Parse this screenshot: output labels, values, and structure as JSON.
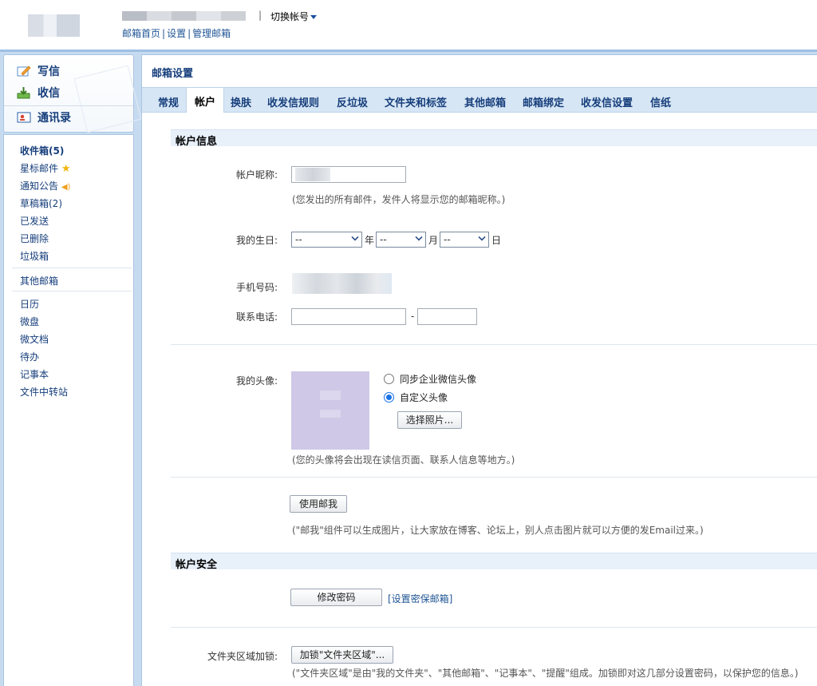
{
  "header": {
    "switch_account": "切换帐号",
    "links": [
      "邮箱首页",
      "设置",
      "管理邮箱"
    ],
    "separator": "|"
  },
  "sidebar": {
    "actions": [
      {
        "label": "写信",
        "icon": "compose-icon"
      },
      {
        "label": "收信",
        "icon": "inbox-download-icon"
      },
      {
        "label": "通讯录",
        "icon": "contacts-icon"
      }
    ],
    "folders": [
      {
        "label": "收件箱(5)",
        "bold": true
      },
      {
        "label": "星标邮件",
        "icon": "star-icon"
      },
      {
        "label": "通知公告",
        "icon": "speaker-icon"
      },
      {
        "label": "草稿箱(2)"
      },
      {
        "label": "已发送"
      },
      {
        "label": "已删除"
      },
      {
        "label": "垃圾箱"
      }
    ],
    "other_mail": "其他邮箱",
    "tools": [
      "日历",
      "微盘",
      "微文档",
      "待办",
      "记事本",
      "文件中转站"
    ]
  },
  "main": {
    "title": "邮箱设置",
    "tabs": [
      "常规",
      "帐户",
      "换肤",
      "收发信规则",
      "反垃圾",
      "文件夹和标签",
      "其他邮箱",
      "邮箱绑定",
      "收发信设置",
      "信纸"
    ],
    "active_tab": "帐户",
    "account_info": {
      "heading": "帐户信息",
      "nickname_label": "帐户昵称:",
      "nickname_hint": "(您发出的所有邮件，发件人将显示您的邮箱昵称。)",
      "birthday_label": "我的生日:",
      "birthday": {
        "year": "--",
        "month": "--",
        "day": "--",
        "year_unit": "年",
        "month_unit": "月",
        "day_unit": "日"
      },
      "phone_label": "手机号码:",
      "tel_label": "联系电话:",
      "tel_sep": "-",
      "avatar_label": "我的头像:",
      "avatar_options": [
        "同步企业微信头像",
        "自定义头像"
      ],
      "avatar_selected": "自定义头像",
      "choose_photo": "选择照片...",
      "avatar_hint": "(您的头像将会出现在读信页面、联系人信息等地方。)",
      "use_me_button": "使用邮我",
      "use_me_hint": "(\"邮我\"组件可以生成图片，让大家放在博客、论坛上，别人点击图片就可以方便的发Email过来。)"
    },
    "account_security": {
      "heading": "帐户安全",
      "change_password": "修改密码",
      "set_security_mail": "[设置密保邮箱]",
      "folder_lock_label": "文件夹区域加锁:",
      "folder_lock_button": "加锁\"文件夹区域\"...",
      "folder_lock_hint": "(\"文件夹区域\"是由\"我的文件夹\"、\"其他邮箱\"、\"记事本\"、\"提醒\"组成。加锁即对这几部分设置密码，以保护您的信息。)"
    }
  },
  "colors": {
    "frame_blue": "#c7dbf0",
    "link_blue": "#1e5494",
    "tab_bar": "#d7e6f5",
    "section_head": "#e8f0fa",
    "radio_blue": "#1a73e8"
  }
}
